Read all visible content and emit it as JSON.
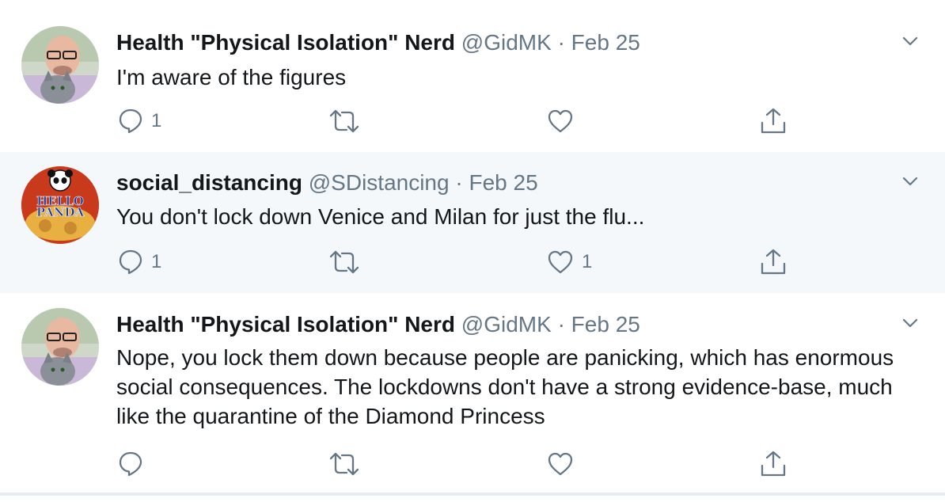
{
  "tweets": [
    {
      "name": "Health \"Physical Isolation\" Nerd",
      "handle": "@GidMK",
      "separator": "·",
      "date": "Feb 25",
      "text": "I'm aware of the figures",
      "reply_count": "1",
      "retweet_count": "",
      "like_count": ""
    },
    {
      "name": "social_distancing",
      "handle": "@SDistancing",
      "separator": "·",
      "date": "Feb 25",
      "text": "You don't lock down Venice and Milan for just the flu...",
      "reply_count": "1",
      "retweet_count": "",
      "like_count": "1",
      "avatar_text": "HELLO PANDA"
    },
    {
      "name": "Health \"Physical Isolation\" Nerd",
      "handle": "@GidMK",
      "separator": "·",
      "date": "Feb 25",
      "text": "Nope, you lock them down because people are panicking, which has enormous social consequences. The lockdowns don't have a strong evidence-base, much like the quarantine of the Diamond Princess",
      "reply_count": "",
      "retweet_count": "",
      "like_count": ""
    }
  ],
  "icons": {
    "reply": "reply-icon",
    "retweet": "retweet-icon",
    "like": "heart-icon",
    "share": "share-icon",
    "more": "chevron-down-icon"
  },
  "colors": {
    "text": "#14171a",
    "muted": "#657786",
    "highlight_bg": "#f5f8fa",
    "thread_line": "#ccd6dd"
  }
}
